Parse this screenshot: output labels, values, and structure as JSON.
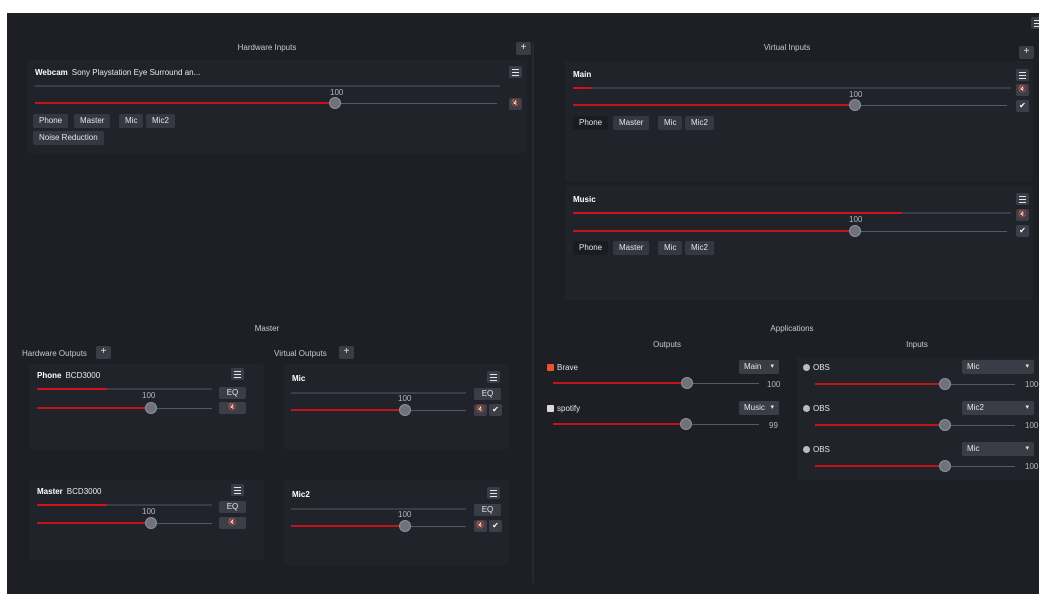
{
  "hardware_inputs": {
    "title": "Hardware Inputs",
    "add_label": "+",
    "devices": [
      {
        "name": "Webcam",
        "device": "Sony Playstation Eye Surround an...",
        "meter": 0,
        "volume": 100,
        "volume_label": "100",
        "routes": [
          "Phone",
          "Master",
          "Mic",
          "Mic2"
        ],
        "extra": "Noise Reduction"
      }
    ]
  },
  "virtual_inputs": {
    "title": "Virtual Inputs",
    "add_label": "+",
    "items": [
      {
        "name": "Main",
        "meter": 0.04,
        "volume": 100,
        "volume_label": "100",
        "routes": [
          "Phone",
          "Master",
          "Mic",
          "Mic2"
        ],
        "active_route": "Phone"
      },
      {
        "name": "Music",
        "meter": 0.75,
        "volume": 100,
        "volume_label": "100",
        "routes": [
          "Phone",
          "Master",
          "Mic",
          "Mic2"
        ],
        "active_route": "Phone"
      }
    ]
  },
  "master": {
    "title": "Master",
    "hardware_outputs": {
      "title": "Hardware Outputs",
      "add_label": "+",
      "items": [
        {
          "name": "Phone",
          "device": "BCD3000",
          "meter": 0.4,
          "volume": 100,
          "volume_label": "100",
          "eq_label": "EQ"
        },
        {
          "name": "Master",
          "device": "BCD3000",
          "meter": 0.4,
          "volume": 100,
          "volume_label": "100",
          "eq_label": "EQ"
        }
      ]
    },
    "virtual_outputs": {
      "title": "Virtual Outputs",
      "add_label": "+",
      "items": [
        {
          "name": "Mic",
          "meter": 0,
          "volume": 100,
          "volume_label": "100",
          "eq_label": "EQ"
        },
        {
          "name": "Mic2",
          "meter": 0,
          "volume": 100,
          "volume_label": "100",
          "eq_label": "EQ"
        }
      ]
    }
  },
  "applications": {
    "title": "Applications",
    "outputs": {
      "title": "Outputs",
      "items": [
        {
          "name": "Brave",
          "icon": "brave-lion-icon",
          "icon_color": "#e8542c",
          "target": "Main",
          "volume": 100,
          "volume_label": "100"
        },
        {
          "name": "spotify",
          "icon": "spotify-icon",
          "icon_color": "#d9d9d9",
          "target": "Music",
          "volume": 99,
          "volume_label": "99"
        }
      ]
    },
    "inputs": {
      "title": "Inputs",
      "items": [
        {
          "name": "OBS",
          "icon": "obs-icon",
          "target": "Mic",
          "volume": 100,
          "volume_label": "100"
        },
        {
          "name": "OBS",
          "icon": "obs-icon",
          "target": "Mic2",
          "volume": 100,
          "volume_label": "100"
        },
        {
          "name": "OBS",
          "icon": "obs-icon",
          "target": "Mic",
          "volume": 100,
          "volume_label": "100"
        }
      ]
    }
  },
  "icons": {
    "mute": "🔇",
    "check": "✔",
    "caret": "▾",
    "menu": "≡"
  },
  "colors": {
    "background": "#1d1f25",
    "accent": "#d0141a",
    "button": "#353842"
  }
}
